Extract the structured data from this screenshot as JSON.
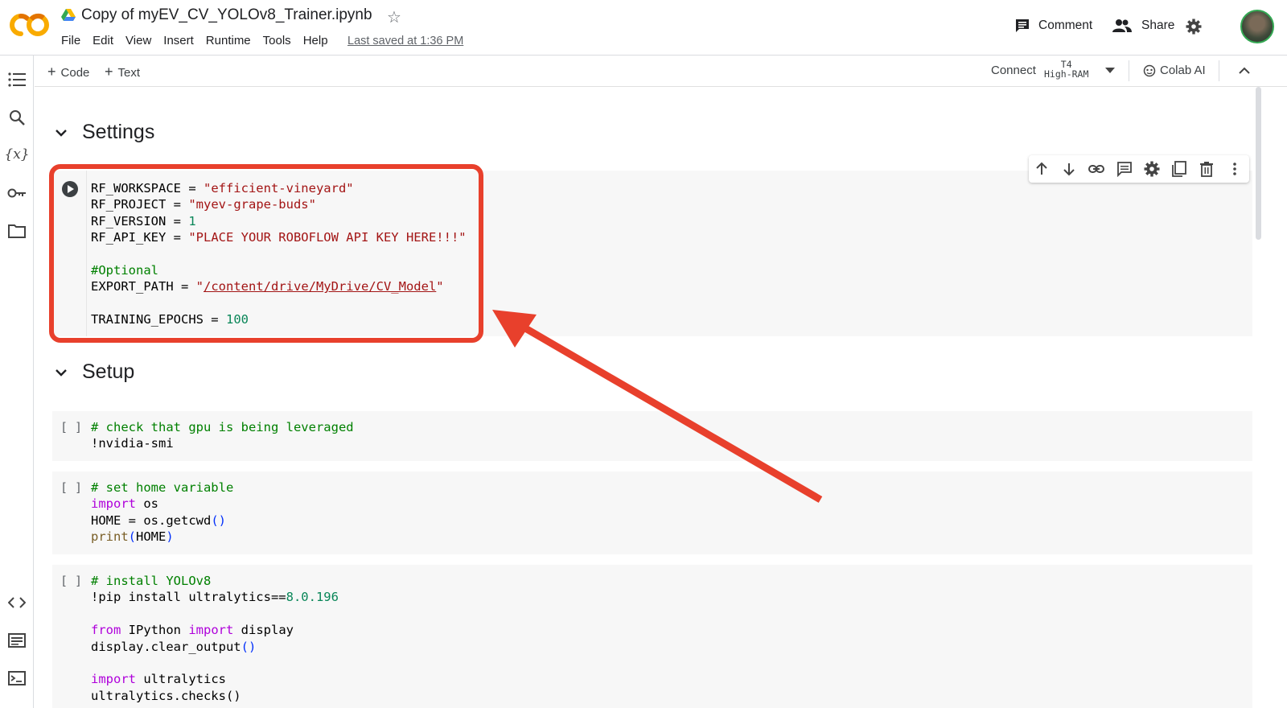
{
  "app": {
    "notebook_title": "Copy of myEV_CV_YOLOv8_Trainer.ipynb",
    "menu": [
      "File",
      "Edit",
      "View",
      "Insert",
      "Runtime",
      "Tools",
      "Help"
    ],
    "last_saved": "Last saved at 1:36 PM",
    "comment_label": "Comment",
    "share_label": "Share"
  },
  "toolbar": {
    "add_code": "Code",
    "add_text": "Text",
    "connect": "Connect",
    "runtime_gpu": "T4",
    "runtime_ram": "High-RAM",
    "colab_ai": "Colab AI"
  },
  "sections": {
    "settings": "Settings",
    "setup": "Setup"
  },
  "cells": {
    "settings_code": {
      "line1_var": "RF_WORKSPACE = ",
      "line1_val": "\"efficient-vineyard\"",
      "line2_var": "RF_PROJECT = ",
      "line2_val": "\"myev-grape-buds\"",
      "line3_var": "RF_VERSION = ",
      "line3_val": "1",
      "line4_var": "RF_API_KEY = ",
      "line4_val": "\"PLACE YOUR ROBOFLOW API KEY HERE!!!\"",
      "comment": "#Optional",
      "export_var": "EXPORT_PATH = ",
      "export_q1": "\"",
      "export_path": "/content/drive/MyDrive/CV_Model",
      "export_q2": "\"",
      "epochs_var": "TRAINING_EPOCHS = ",
      "epochs_val": "100"
    },
    "gpu_cell": {
      "bracket": "[ ]",
      "comment": "# check that gpu is being leveraged",
      "cmd": "!nvidia-smi"
    },
    "home_cell": {
      "bracket": "[ ]",
      "comment": "# set home variable",
      "import_kw": "import",
      "import_mod": " os",
      "assign": "HOME = os.getcwd",
      "print_fn": "print",
      "print_arg": "HOME"
    },
    "install_cell": {
      "bracket": "[ ]",
      "comment": "# install YOLOv8",
      "pip": "!pip install ultralytics==",
      "pip_ver": "8.0.196",
      "from_kw": "from",
      "from_mod": " IPython ",
      "import_kw": "import",
      "import_name": " display",
      "clear": "display.clear_output",
      "import2_kw": "import",
      "import2_mod": " ultralytics",
      "checks": "ultralytics.checks()"
    }
  },
  "colors": {
    "annotation_red": "#e8402c",
    "string": "#a31515",
    "number": "#098658",
    "keyword": "#af00db",
    "comment": "#008000"
  }
}
